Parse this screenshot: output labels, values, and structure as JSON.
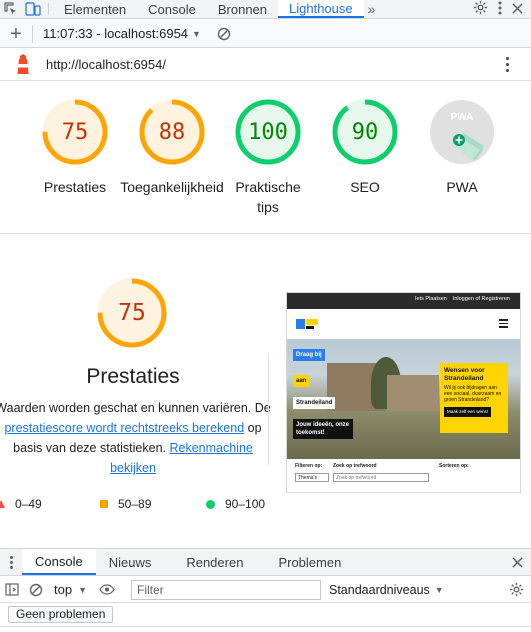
{
  "devtools": {
    "tabs": [
      "Elementen",
      "Console",
      "Bronnen",
      "Lighthouse"
    ],
    "active_tab": "Lighthouse",
    "more": "»"
  },
  "lh_toolbar": {
    "report": "11:07:33 - localhost:6954"
  },
  "url": "http://localhost:6954/",
  "scores": [
    {
      "label": "Prestaties",
      "score": 75,
      "color": "#ffa400",
      "text_color": "#c33300"
    },
    {
      "label": "Toegankelijkheid",
      "score": 88,
      "color": "#ffa400",
      "text_color": "#c33300"
    },
    {
      "label": "Praktische tips",
      "score": 100,
      "color": "#0cce6b",
      "text_color": "#008800"
    },
    {
      "label": "SEO",
      "score": 90,
      "color": "#0cce6b",
      "text_color": "#008800"
    },
    {
      "label": "PWA",
      "badge": "PWA"
    }
  ],
  "detail": {
    "score": 75,
    "title": "Prestaties",
    "desc_before": "Waarden worden geschat en kunnen variëren. De ",
    "link1": "prestatiescore wordt rechtstreeks berekend",
    "desc_mid": " op basis van deze statistieken. ",
    "link2": "Rekenmachine bekijken"
  },
  "legend": [
    "0–49",
    "50–89",
    "90–100"
  ],
  "screenshot": {
    "links": [
      "Iets Plaatsen",
      "Inloggen of Registreren"
    ],
    "tag1": "Draag bij",
    "tag2": "aan",
    "tag3": "Strandeiland",
    "tag4": "Jouw ideeën, onze toekomst!",
    "card_title": "Wensen voor Strandeiland",
    "card_text": "Wil jij ook bijdragen aan een sociaal, duurzaam en groen Strandeiland?",
    "card_button": "Maak zelf een wens!",
    "filter_label": "Filteren op:",
    "search_label": "Zoek op trefwoord",
    "sort_label": "Sorteren op:",
    "filter_value": "Thema's",
    "search_placeholder": "Zoek op trefwoord"
  },
  "drawer": {
    "tabs": [
      "Console",
      "Nieuws",
      "Renderen",
      "Problemen"
    ],
    "active_tab": "Console"
  },
  "console": {
    "context": "top",
    "filter_placeholder": "Filter",
    "levels": "Standaardniveaus",
    "no_issues": "Geen problemen"
  }
}
